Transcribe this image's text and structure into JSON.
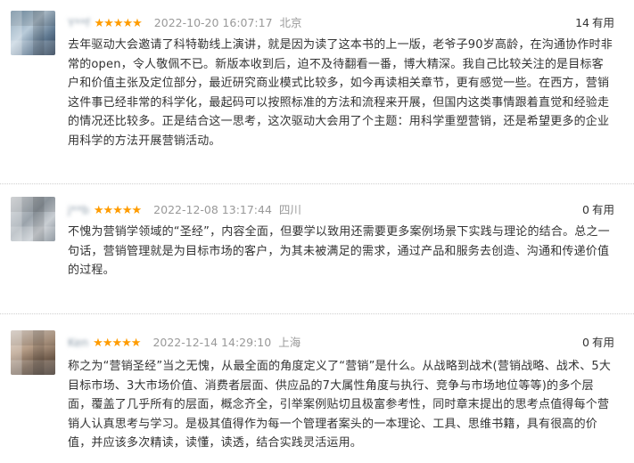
{
  "reviews": [
    {
      "username": "Y**f",
      "stars": "★★★★★",
      "date": "2022-10-20 16:07:17",
      "location": "北京",
      "useful_count": "14",
      "useful_label": "有用",
      "content": "去年驱动大会邀请了科特勒线上演讲，就是因为读了这本书的上一版，老爷子90岁高龄，在沟通协作时非常的open，令人敬佩不已。新版本收到后，迫不及待翻看一番，博大精深。我自己比较关注的是目标客户和价值主张及定位部分，最近研究商业模式比较多，如今再读相关章节，更有感觉一些。在西方，营销这件事已经非常的科学化，最起码可以按照标准的方法和流程来开展，但国内这类事情跟着直觉和经验走的情况还比较多。正是结合这一思考，这次驱动大会用了个主题：用科学重塑营销，还是希望更多的企业用科学的方法开展营销活动。"
    },
    {
      "username": "j**b",
      "stars": "★★★★★",
      "date": "2022-12-08 13:17:44",
      "location": "四川",
      "useful_count": "0",
      "useful_label": "有用",
      "content": "不愧为营销学领域的“圣经”，内容全面，但要学以致用还需要更多案例场景下实践与理论的结合。总之一句话，营销管理就是为目标市场的客户，为其未被满足的需求，通过产品和服务去创造、沟通和传递价值的过程。"
    },
    {
      "username": "Ken",
      "stars": "★★★★★",
      "date": "2022-12-14 14:29:10",
      "location": "上海",
      "useful_count": "0",
      "useful_label": "有用",
      "content": "称之为“营销圣经”当之无愧，从最全面的角度定义了“营销”是什么。从战略到战术(营销战略、战术、5大目标市场、3大市场价值、消费者层面、供应品的7大属性角度与执行、竞争与市场地位等等)的多个层面，覆盖了几乎所有的层面，概念齐全，引举案例贴切且极富参考性，同时章末提出的思考点值得每个营销人认真思考与学习。是极其值得作为每一个管理者案头的一本理论、工具、思维书籍，具有很高的价值，并应该多次精读，读懂，读透，结合实践灵活运用。"
    }
  ]
}
